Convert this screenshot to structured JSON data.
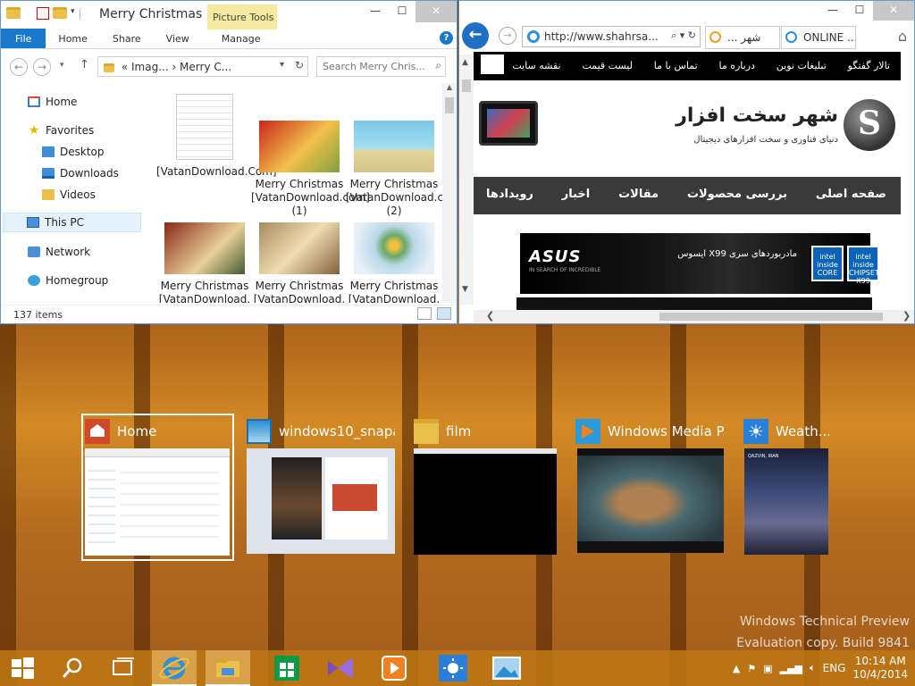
{
  "explorer": {
    "title": "Merry Christmas",
    "contextual_tab": "Picture Tools",
    "ribbon_tabs": [
      "File",
      "Home",
      "Share",
      "View",
      "Manage"
    ],
    "address_path": "« Imag... › Merry C...",
    "search_placeholder": "Search Merry Chris...",
    "sidebar": {
      "home": "Home",
      "favorites": "Favorites",
      "desktop": "Desktop",
      "downloads": "Downloads",
      "videos": "Videos",
      "this_pc": "This PC",
      "network": "Network",
      "homegroup": "Homegroup"
    },
    "files": [
      {
        "name": "[VatanDownload.Com]",
        "icon": "document-icon"
      },
      {
        "name": "Merry Christmas [VatanDownload.com] (1)",
        "icon": "image-icon"
      },
      {
        "name": "Merry Christmas [VatanDownload.com] (2)",
        "icon": "image-icon"
      },
      {
        "name": "Merry Christmas [VatanDownload.",
        "icon": "image-icon"
      },
      {
        "name": "Merry Christmas [VatanDownload.",
        "icon": "image-icon"
      },
      {
        "name": "Merry Christmas [VatanDownload.",
        "icon": "image-icon"
      }
    ],
    "status": "137 items"
  },
  "browser": {
    "url": "http://www.shahrsa...",
    "tabs": [
      "... شهر",
      "ONLINE ..."
    ],
    "top_nav": [
      "تالار گفتگو",
      "تبلیغات نوین",
      "درباره ما",
      "تماس با ما",
      "لیست قیمت",
      "نقشه سایت"
    ],
    "logo_text": "شهر سخت افزار",
    "logo_tagline": "دنیای فناوری و سخت افزارهای دیجیتال",
    "main_nav": [
      "صفحه اصلی",
      "بررسی محصولات",
      "مقالات",
      "اخبار",
      "رویدادها"
    ],
    "banner": {
      "brand": "ASUS",
      "brand_tagline": "IN SEARCH OF INCREDIBLE",
      "text": "مادربوردهای سری X99 ایسوس",
      "chip1": "intel inside CORE",
      "chip2": "intel inside CHIPSET X99"
    }
  },
  "task_view": [
    {
      "title": "Home",
      "icon": "explorer-home-icon",
      "selected": true
    },
    {
      "title": "windows10_snapa...",
      "icon": "photos-icon",
      "selected": false
    },
    {
      "title": "film",
      "icon": "folder-icon",
      "selected": false
    },
    {
      "title": "Windows Media P...",
      "icon": "media-player-icon",
      "selected": false
    },
    {
      "title": "Weath...",
      "icon": "weather-icon",
      "selected": false
    }
  ],
  "weather_thumb": {
    "location": "QAZVIN, IRAN"
  },
  "watermark": {
    "line1": "Windows Technical Preview",
    "line2": "Evaluation copy. Build 9841"
  },
  "taskbar": {
    "language": "ENG",
    "time": "10:14 AM",
    "date": "10/4/2014"
  },
  "colors": {
    "accent": "#1979ca",
    "taskbar": "#be7814"
  }
}
